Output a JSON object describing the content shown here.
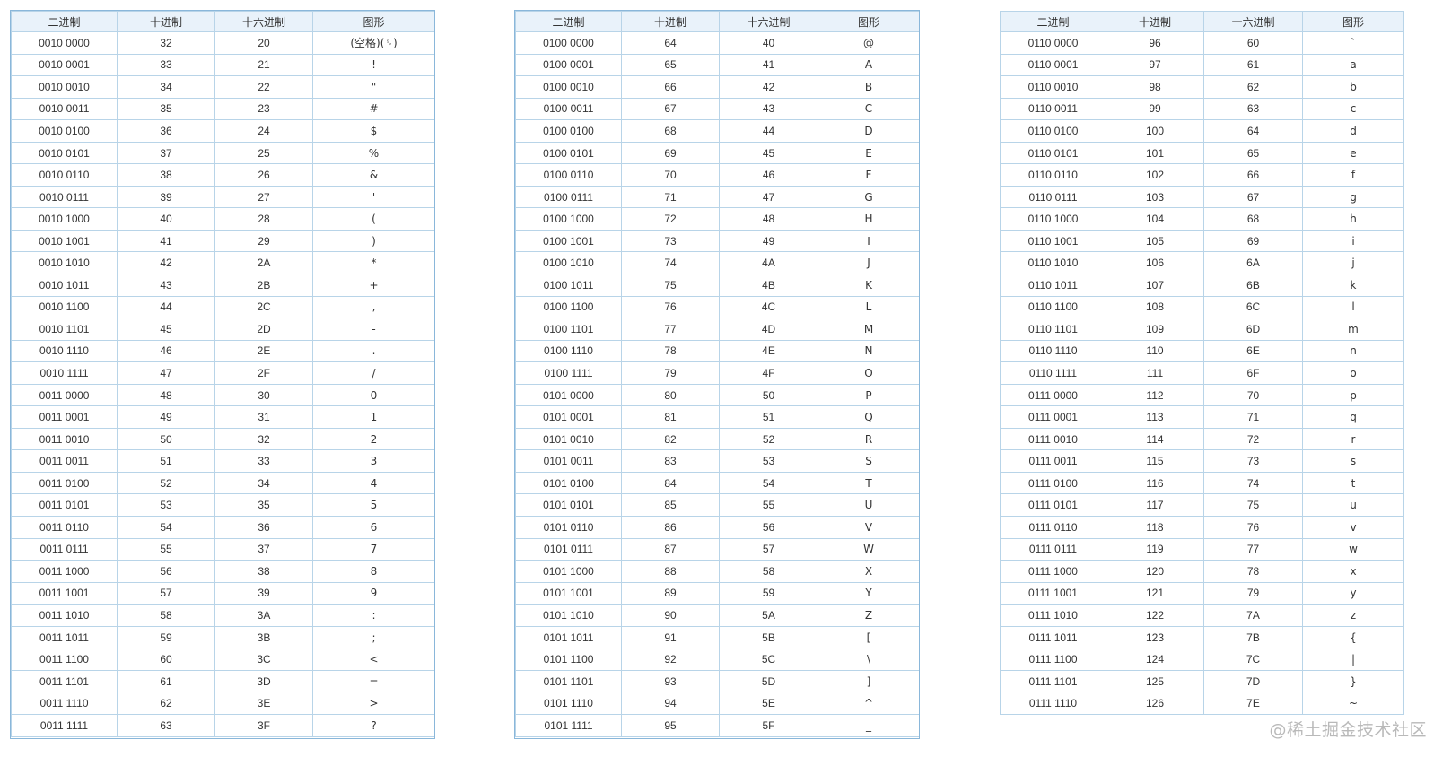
{
  "headers": [
    "二进制",
    "十进制",
    "十六进制",
    "图形"
  ],
  "watermark": "@稀土掘金技术社区",
  "tables": [
    {
      "rows": [
        [
          "0010 0000",
          "32",
          "20",
          "(空格)(␠)"
        ],
        [
          "0010 0001",
          "33",
          "21",
          "!"
        ],
        [
          "0010 0010",
          "34",
          "22",
          "\""
        ],
        [
          "0010 0011",
          "35",
          "23",
          "#"
        ],
        [
          "0010 0100",
          "36",
          "24",
          "$"
        ],
        [
          "0010 0101",
          "37",
          "25",
          "%"
        ],
        [
          "0010 0110",
          "38",
          "26",
          "&"
        ],
        [
          "0010 0111",
          "39",
          "27",
          "'"
        ],
        [
          "0010 1000",
          "40",
          "28",
          "("
        ],
        [
          "0010 1001",
          "41",
          "29",
          ")"
        ],
        [
          "0010 1010",
          "42",
          "2A",
          "*"
        ],
        [
          "0010 1011",
          "43",
          "2B",
          "+"
        ],
        [
          "0010 1100",
          "44",
          "2C",
          ","
        ],
        [
          "0010 1101",
          "45",
          "2D",
          "-"
        ],
        [
          "0010 1110",
          "46",
          "2E",
          "."
        ],
        [
          "0010 1111",
          "47",
          "2F",
          "/"
        ],
        [
          "0011 0000",
          "48",
          "30",
          "0"
        ],
        [
          "0011 0001",
          "49",
          "31",
          "1"
        ],
        [
          "0011 0010",
          "50",
          "32",
          "2"
        ],
        [
          "0011 0011",
          "51",
          "33",
          "3"
        ],
        [
          "0011 0100",
          "52",
          "34",
          "4"
        ],
        [
          "0011 0101",
          "53",
          "35",
          "5"
        ],
        [
          "0011 0110",
          "54",
          "36",
          "6"
        ],
        [
          "0011 0111",
          "55",
          "37",
          "7"
        ],
        [
          "0011 1000",
          "56",
          "38",
          "8"
        ],
        [
          "0011 1001",
          "57",
          "39",
          "9"
        ],
        [
          "0011 1010",
          "58",
          "3A",
          ":"
        ],
        [
          "0011 1011",
          "59",
          "3B",
          ";"
        ],
        [
          "0011 1100",
          "60",
          "3C",
          "<"
        ],
        [
          "0011 1101",
          "61",
          "3D",
          "="
        ],
        [
          "0011 1110",
          "62",
          "3E",
          ">"
        ],
        [
          "0011 1111",
          "63",
          "3F",
          "?"
        ]
      ]
    },
    {
      "rows": [
        [
          "0100 0000",
          "64",
          "40",
          "@"
        ],
        [
          "0100 0001",
          "65",
          "41",
          "A"
        ],
        [
          "0100 0010",
          "66",
          "42",
          "B"
        ],
        [
          "0100 0011",
          "67",
          "43",
          "C"
        ],
        [
          "0100 0100",
          "68",
          "44",
          "D"
        ],
        [
          "0100 0101",
          "69",
          "45",
          "E"
        ],
        [
          "0100 0110",
          "70",
          "46",
          "F"
        ],
        [
          "0100 0111",
          "71",
          "47",
          "G"
        ],
        [
          "0100 1000",
          "72",
          "48",
          "H"
        ],
        [
          "0100 1001",
          "73",
          "49",
          "I"
        ],
        [
          "0100 1010",
          "74",
          "4A",
          "J"
        ],
        [
          "0100 1011",
          "75",
          "4B",
          "K"
        ],
        [
          "0100 1100",
          "76",
          "4C",
          "L"
        ],
        [
          "0100 1101",
          "77",
          "4D",
          "M"
        ],
        [
          "0100 1110",
          "78",
          "4E",
          "N"
        ],
        [
          "0100 1111",
          "79",
          "4F",
          "O"
        ],
        [
          "0101 0000",
          "80",
          "50",
          "P"
        ],
        [
          "0101 0001",
          "81",
          "51",
          "Q"
        ],
        [
          "0101 0010",
          "82",
          "52",
          "R"
        ],
        [
          "0101 0011",
          "83",
          "53",
          "S"
        ],
        [
          "0101 0100",
          "84",
          "54",
          "T"
        ],
        [
          "0101 0101",
          "85",
          "55",
          "U"
        ],
        [
          "0101 0110",
          "86",
          "56",
          "V"
        ],
        [
          "0101 0111",
          "87",
          "57",
          "W"
        ],
        [
          "0101 1000",
          "88",
          "58",
          "X"
        ],
        [
          "0101 1001",
          "89",
          "59",
          "Y"
        ],
        [
          "0101 1010",
          "90",
          "5A",
          "Z"
        ],
        [
          "0101 1011",
          "91",
          "5B",
          "["
        ],
        [
          "0101 1100",
          "92",
          "5C",
          "\\"
        ],
        [
          "0101 1101",
          "93",
          "5D",
          "]"
        ],
        [
          "0101 1110",
          "94",
          "5E",
          "^"
        ],
        [
          "0101 1111",
          "95",
          "5F",
          "_"
        ]
      ]
    },
    {
      "rows": [
        [
          "0110 0000",
          "96",
          "60",
          "`"
        ],
        [
          "0110 0001",
          "97",
          "61",
          "a"
        ],
        [
          "0110 0010",
          "98",
          "62",
          "b"
        ],
        [
          "0110 0011",
          "99",
          "63",
          "c"
        ],
        [
          "0110 0100",
          "100",
          "64",
          "d"
        ],
        [
          "0110 0101",
          "101",
          "65",
          "e"
        ],
        [
          "0110 0110",
          "102",
          "66",
          "f"
        ],
        [
          "0110 0111",
          "103",
          "67",
          "g"
        ],
        [
          "0110 1000",
          "104",
          "68",
          "h"
        ],
        [
          "0110 1001",
          "105",
          "69",
          "i"
        ],
        [
          "0110 1010",
          "106",
          "6A",
          "j"
        ],
        [
          "0110 1011",
          "107",
          "6B",
          "k"
        ],
        [
          "0110 1100",
          "108",
          "6C",
          "l"
        ],
        [
          "0110 1101",
          "109",
          "6D",
          "m"
        ],
        [
          "0110 1110",
          "110",
          "6E",
          "n"
        ],
        [
          "0110 1111",
          "111",
          "6F",
          "o"
        ],
        [
          "0111 0000",
          "112",
          "70",
          "p"
        ],
        [
          "0111 0001",
          "113",
          "71",
          "q"
        ],
        [
          "0111 0010",
          "114",
          "72",
          "r"
        ],
        [
          "0111 0011",
          "115",
          "73",
          "s"
        ],
        [
          "0111 0100",
          "116",
          "74",
          "t"
        ],
        [
          "0111 0101",
          "117",
          "75",
          "u"
        ],
        [
          "0111 0110",
          "118",
          "76",
          "v"
        ],
        [
          "0111 0111",
          "119",
          "77",
          "w"
        ],
        [
          "0111 1000",
          "120",
          "78",
          "x"
        ],
        [
          "0111 1001",
          "121",
          "79",
          "y"
        ],
        [
          "0111 1010",
          "122",
          "7A",
          "z"
        ],
        [
          "0111 1011",
          "123",
          "7B",
          "{"
        ],
        [
          "0111 1100",
          "124",
          "7C",
          "|"
        ],
        [
          "0111 1101",
          "125",
          "7D",
          "}"
        ],
        [
          "0111 1110",
          "126",
          "7E",
          "~"
        ]
      ]
    }
  ]
}
